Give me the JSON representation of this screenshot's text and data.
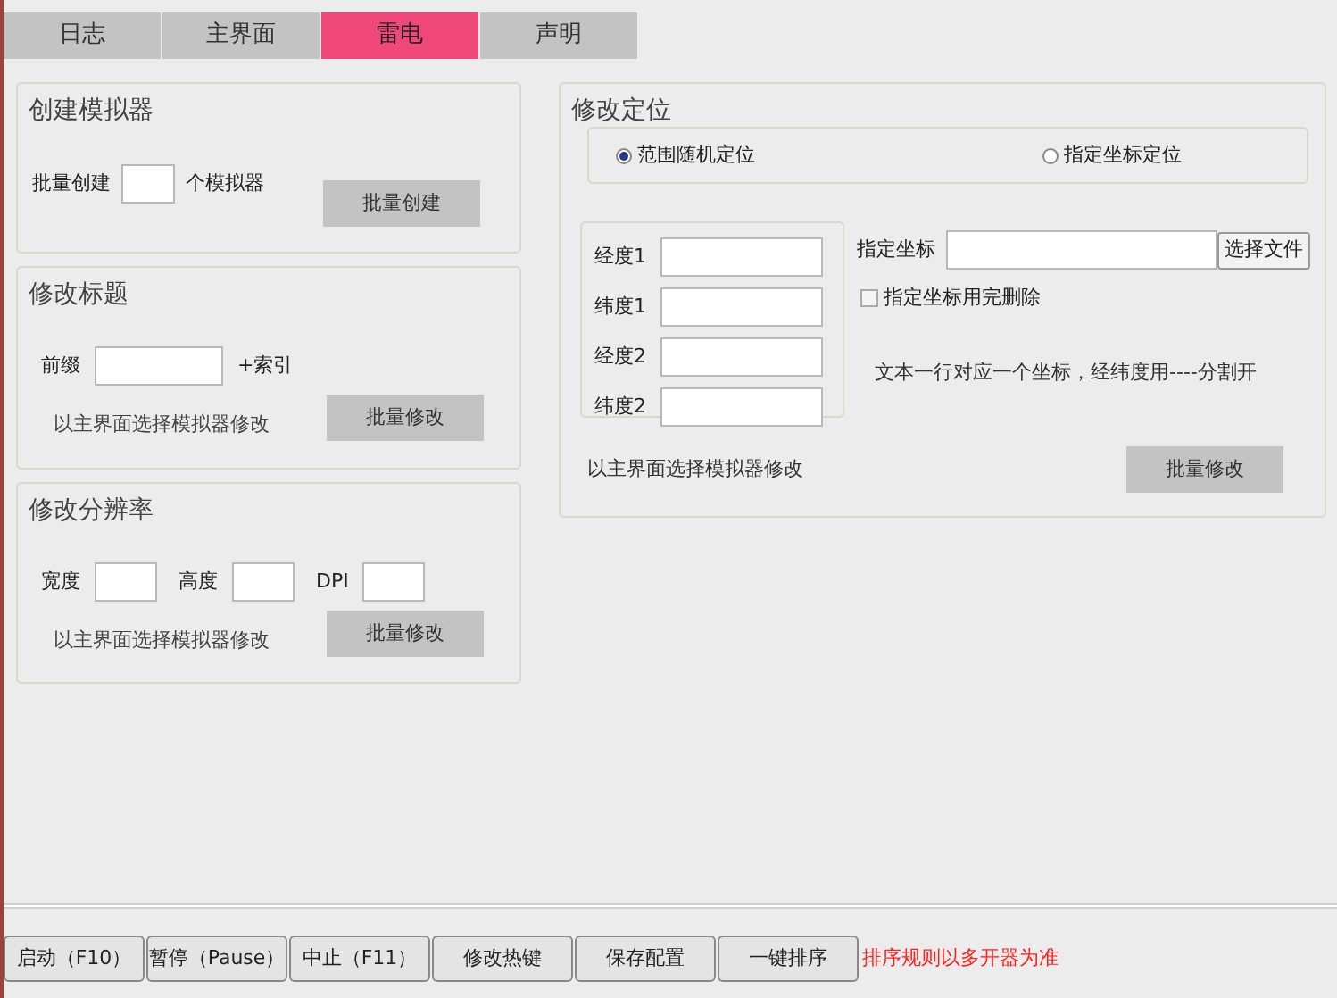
{
  "tabs": [
    {
      "label": "日志",
      "selected": false
    },
    {
      "label": "主界面",
      "selected": false
    },
    {
      "label": "雷电",
      "selected": true
    },
    {
      "label": "声明",
      "selected": false
    }
  ],
  "create_emulator": {
    "title": "创建模拟器",
    "label": "批量创建",
    "suffix": "个模拟器",
    "button": "批量创建"
  },
  "modify_title": {
    "title": "修改标题",
    "label": "前缀",
    "suffix": "+索引",
    "note": "以主界面选择模拟器修改",
    "button": "批量修改"
  },
  "modify_resolution": {
    "title": "修改分辨率",
    "fields": [
      {
        "label": "宽度"
      },
      {
        "label": "高度"
      },
      {
        "label": "DPI"
      }
    ],
    "note": "以主界面选择模拟器修改",
    "button": "批量修改"
  },
  "modify_location": {
    "title": "修改定位",
    "modes": [
      {
        "label": "范围随机定位",
        "selected": true
      },
      {
        "label": "指定坐标定位",
        "selected": false
      }
    ],
    "coords": [
      {
        "label": "经度1"
      },
      {
        "label": "纬度1"
      },
      {
        "label": "经度2"
      },
      {
        "label": "纬度2"
      }
    ],
    "file_label": "指定坐标",
    "file_button": "选择文件",
    "delete_after": {
      "label": "指定坐标用完删除",
      "checked": false
    },
    "hint": "文本一行对应一个坐标，经纬度用----分割开",
    "note": "以主界面选择模拟器修改",
    "button": "批量修改"
  },
  "bottom_buttons": [
    "启动（F10）",
    "暂停（Pause）",
    "中止（F11）",
    "修改热键",
    "保存配置",
    "一键排序"
  ],
  "bottom_note": "排序规则以多开器为准"
}
